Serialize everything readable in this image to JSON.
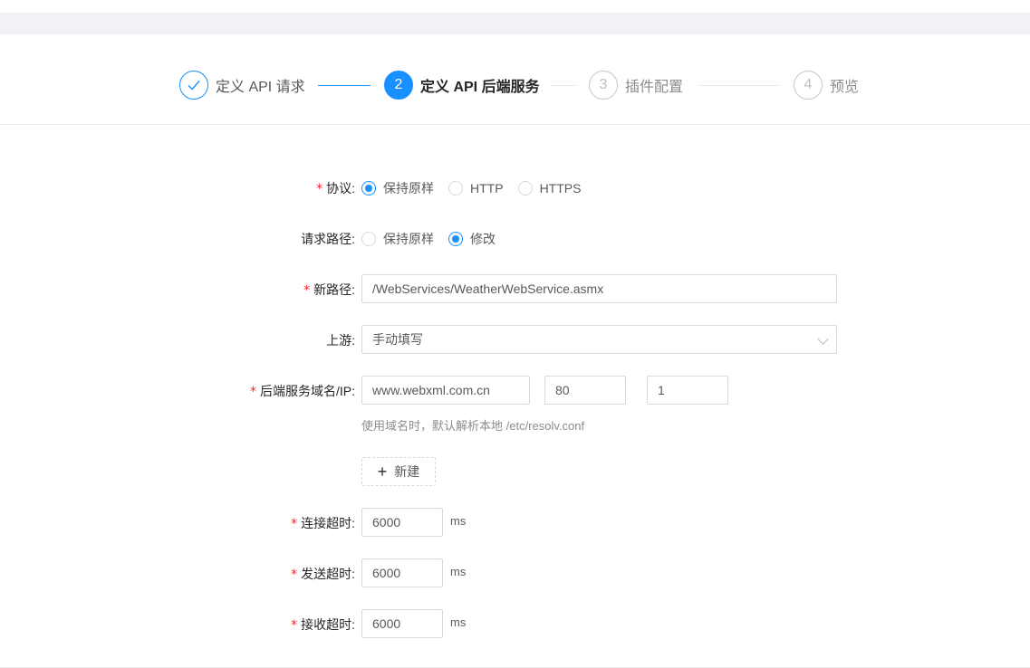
{
  "steps": [
    {
      "index": "1",
      "title": "定义 API 请求",
      "status": "done",
      "icon": "check-icon"
    },
    {
      "index": "2",
      "title": "定义 API 后端服务",
      "status": "active"
    },
    {
      "index": "3",
      "title": "插件配置",
      "status": "wait"
    },
    {
      "index": "4",
      "title": "预览",
      "status": "wait"
    }
  ],
  "form": {
    "protocol": {
      "label": "协议:",
      "required": "*",
      "options": [
        "保持原样",
        "HTTP",
        "HTTPS"
      ],
      "selected": "保持原样"
    },
    "request_path": {
      "label": "请求路径:",
      "options": [
        "保持原样",
        "修改"
      ],
      "selected": "修改"
    },
    "new_path": {
      "label": "新路径:",
      "required": "*",
      "value": "/WebServices/WeatherWebService.asmx"
    },
    "upstream": {
      "label": "上游:",
      "value": "手动填写"
    },
    "backend_host": {
      "label": "后端服务域名/IP:",
      "required": "*",
      "host": "www.webxml.com.cn",
      "port": "80",
      "weight": "1",
      "hint": "使用域名时，默认解析本地 /etc/resolv.conf"
    },
    "new_button": {
      "plus": "+",
      "label": "新建"
    },
    "connect_timeout": {
      "label": "连接超时:",
      "required": "*",
      "value": "6000",
      "unit": "ms"
    },
    "send_timeout": {
      "label": "发送超时:",
      "required": "*",
      "value": "6000",
      "unit": "ms"
    },
    "receive_timeout": {
      "label": "接收超时:",
      "required": "*",
      "value": "6000",
      "unit": "ms"
    }
  },
  "colors": {
    "primary": "#1890ff",
    "required": "#f5222d",
    "border": "#d9d9d9"
  }
}
